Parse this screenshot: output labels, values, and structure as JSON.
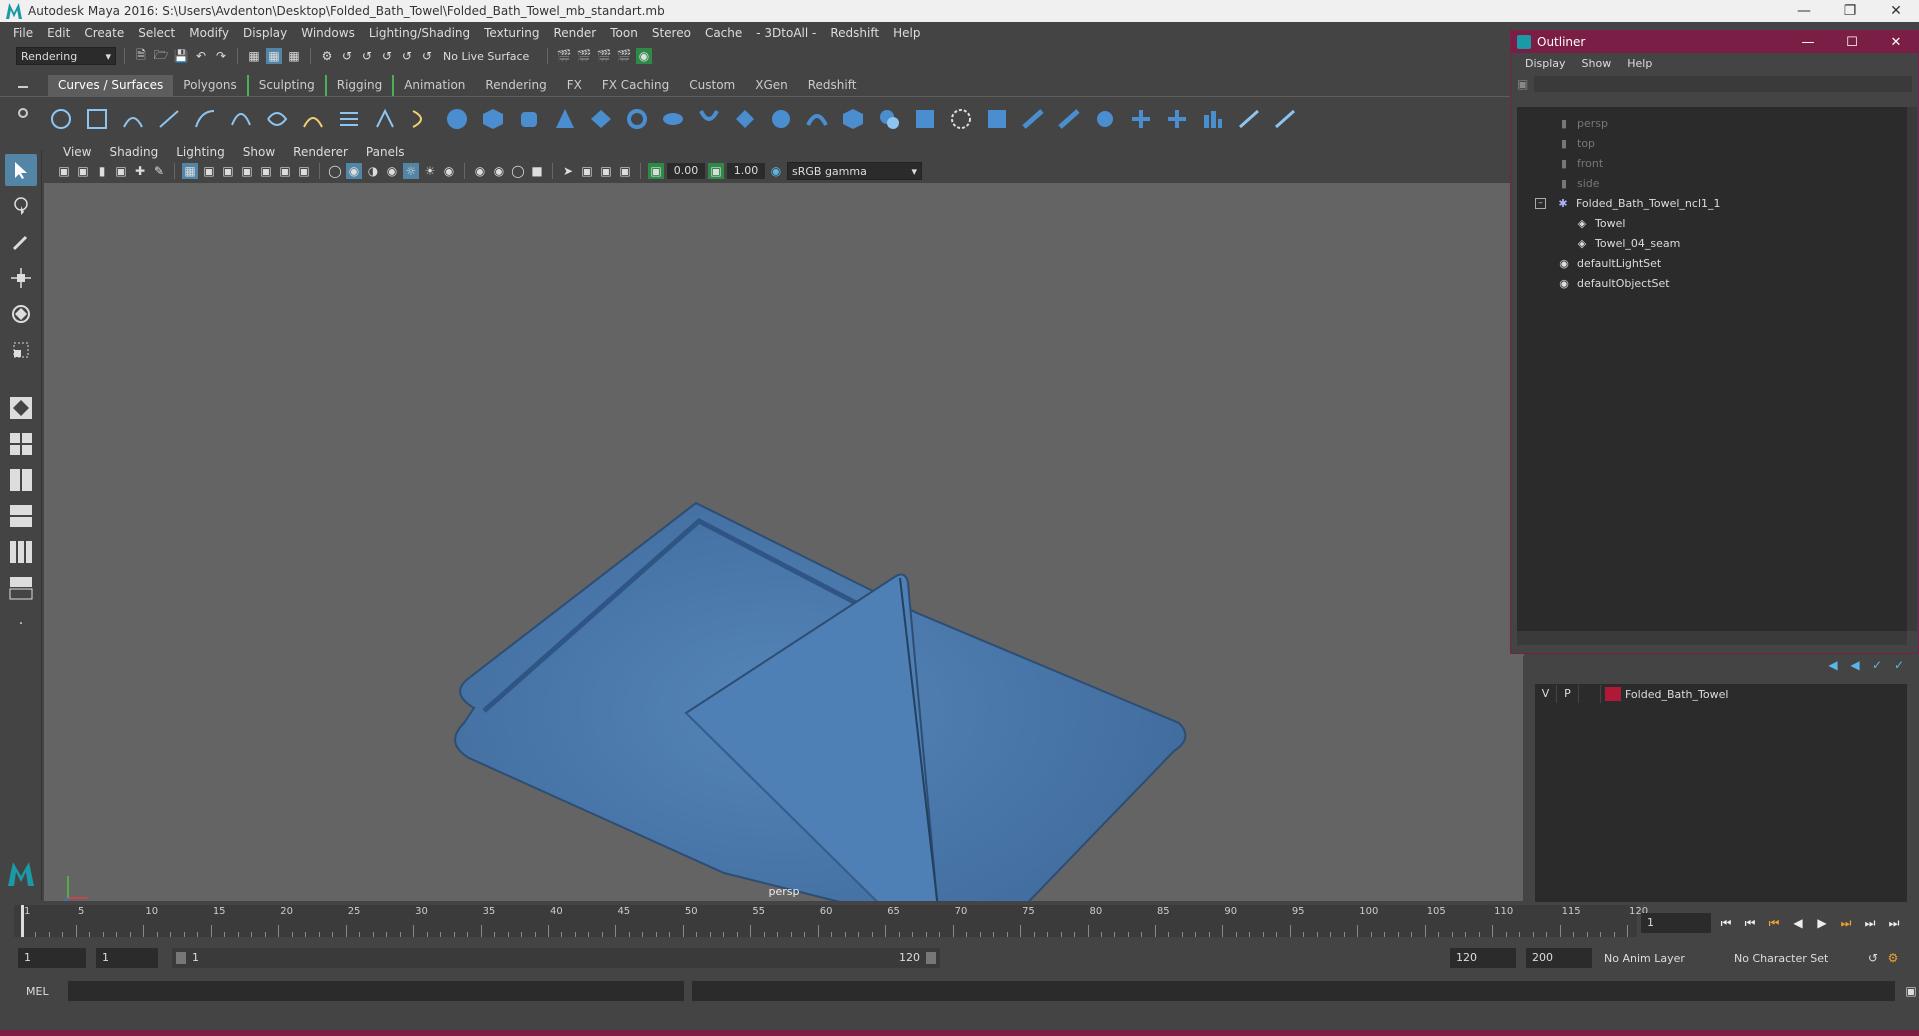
{
  "app": {
    "title": "Autodesk Maya 2016: S:\\Users\\Avdenton\\Desktop\\Folded_Bath_Towel\\Folded_Bath_Towel_mb_standart.mb"
  },
  "menubar": [
    "File",
    "Edit",
    "Create",
    "Select",
    "Modify",
    "Display",
    "Windows",
    "Lighting/Shading",
    "Texturing",
    "Render",
    "Toon",
    "Stereo",
    "Cache",
    "- 3DtoAll -",
    "Redshift",
    "Help"
  ],
  "statusline": {
    "menuset": "Rendering",
    "live_surface": "No Live Surface"
  },
  "shelf_tabs": [
    "Curves / Surfaces",
    "Polygons",
    "Sculpting",
    "Rigging",
    "Animation",
    "Rendering",
    "FX",
    "FX Caching",
    "Custom",
    "XGen",
    "Redshift"
  ],
  "shelf_active_tab": "Curves / Surfaces",
  "viewport": {
    "menus": [
      "View",
      "Shading",
      "Lighting",
      "Show",
      "Renderer",
      "Panels"
    ],
    "exposure": "0.00",
    "gamma": "1.00",
    "color_space": "sRGB gamma",
    "camera_label": "persp",
    "accent": "#4a79ad"
  },
  "outliner": {
    "title": "Outliner",
    "menus": [
      "Display",
      "Show",
      "Help"
    ],
    "items": [
      {
        "label": "persp",
        "icon": "camera-icon"
      },
      {
        "label": "top",
        "icon": "camera-icon"
      },
      {
        "label": "front",
        "icon": "camera-icon"
      },
      {
        "label": "side",
        "icon": "camera-icon"
      },
      {
        "label": "Folded_Bath_Towel_ncl1_1",
        "icon": "group-icon"
      },
      {
        "label": "Towel",
        "icon": "mesh-icon"
      },
      {
        "label": "Towel_04_seam",
        "icon": "mesh-icon"
      },
      {
        "label": "defaultLightSet",
        "icon": "set-icon"
      },
      {
        "label": "defaultObjectSet",
        "icon": "set-icon"
      }
    ]
  },
  "layers": {
    "rows": [
      {
        "v": "V",
        "p": "P",
        "name": "Folded_Bath_Towel",
        "color": "#b01837"
      }
    ]
  },
  "timeline": {
    "ticks": [
      "1",
      "5",
      "10",
      "15",
      "20",
      "25",
      "30",
      "35",
      "40",
      "45",
      "50",
      "55",
      "60",
      "65",
      "70",
      "75",
      "80",
      "85",
      "90",
      "95",
      "100",
      "105",
      "110",
      "115",
      "120"
    ],
    "current_frame": "1"
  },
  "range": {
    "start": "1",
    "start_inner": "1",
    "slider_start": "1",
    "slider_end": "120",
    "end_inner": "120",
    "end": "200",
    "anim_layer": "No Anim Layer",
    "character_set": "No Character Set"
  },
  "command": {
    "language": "MEL"
  }
}
